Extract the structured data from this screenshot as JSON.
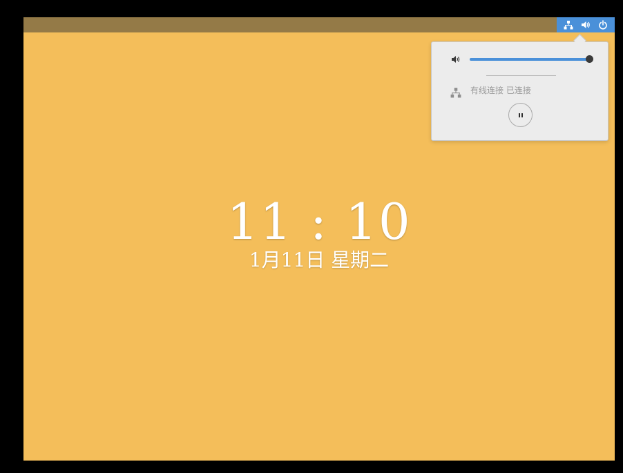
{
  "lockscreen": {
    "time": "11 : 10",
    "date": "1月11日 星期二"
  },
  "tray": {
    "icons": [
      "network-wired-icon",
      "volume-icon",
      "power-icon"
    ]
  },
  "system_menu": {
    "volume_level_percent": 100,
    "network_status": "有线连接 已连接",
    "media_control_icon": "pause-icon"
  },
  "colors": {
    "background": "#f4be5a",
    "topbar": "#947a47",
    "accent": "#4a90d9",
    "popover": "#ececec"
  }
}
